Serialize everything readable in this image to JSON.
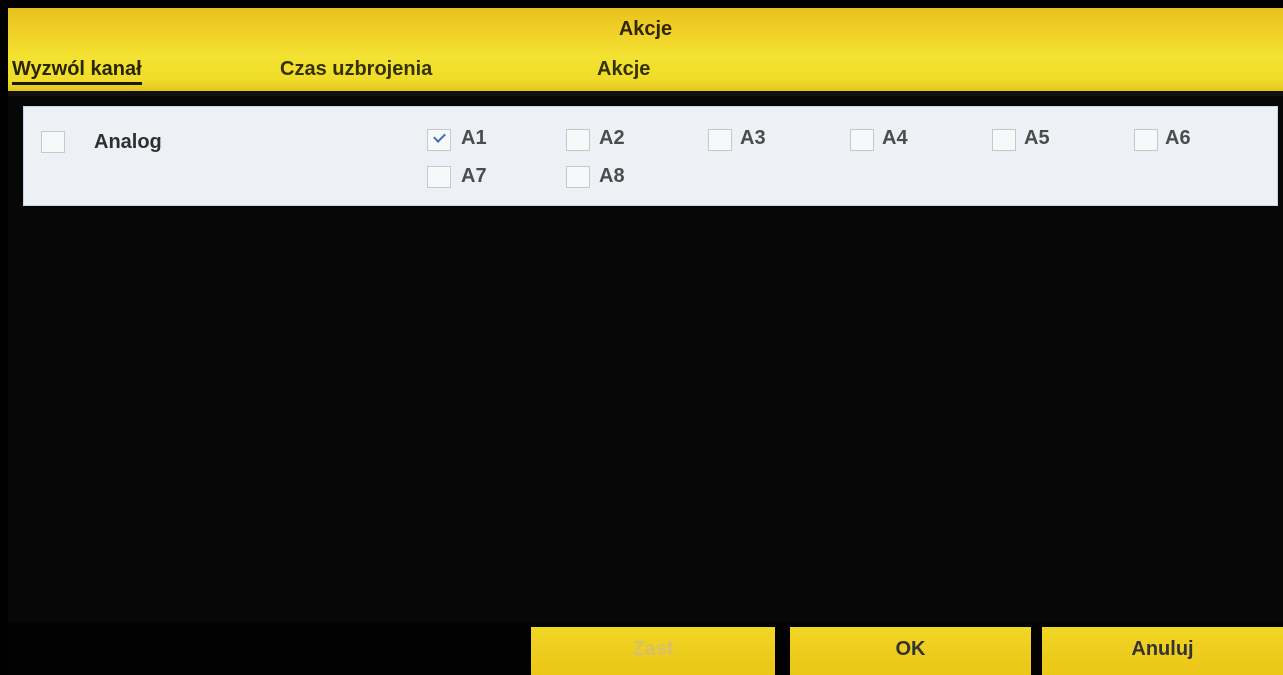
{
  "window": {
    "title": "Akcje"
  },
  "tabs": [
    {
      "label": "Wyzwól kanał",
      "active": true
    },
    {
      "label": "Czas uzbrojenia",
      "active": false
    },
    {
      "label": "Akcje",
      "active": false
    }
  ],
  "panel": {
    "group_label": "Analog",
    "group_checked": false,
    "channels": [
      {
        "label": "A1",
        "checked": true
      },
      {
        "label": "A2",
        "checked": false
      },
      {
        "label": "A3",
        "checked": false
      },
      {
        "label": "A4",
        "checked": false
      },
      {
        "label": "A5",
        "checked": false
      },
      {
        "label": "A6",
        "checked": false
      },
      {
        "label": "A7",
        "checked": false
      },
      {
        "label": "A8",
        "checked": false
      }
    ]
  },
  "buttons": {
    "apply": "Zast",
    "ok": "OK",
    "cancel": "Anuluj"
  },
  "colors": {
    "accent_yellow": "#f0d028",
    "panel_bg": "#edf1f6",
    "check_mark": "#3e6ebd"
  }
}
